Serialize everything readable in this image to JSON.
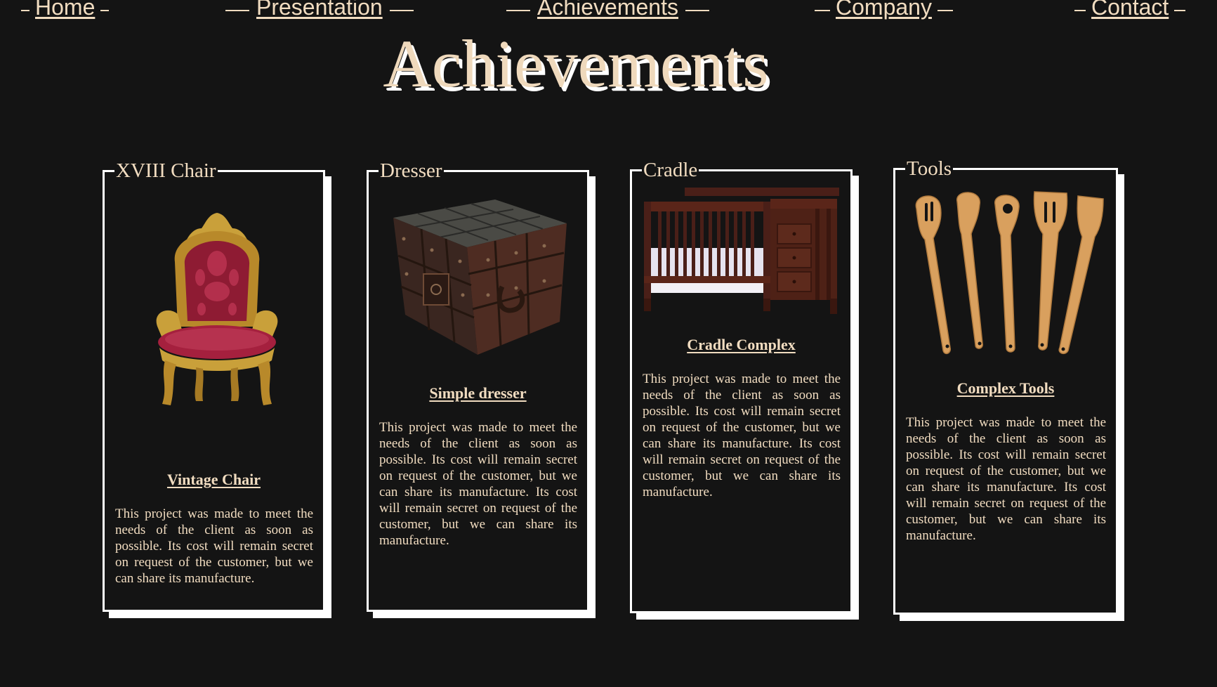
{
  "nav": {
    "items": [
      {
        "label": "Home"
      },
      {
        "label": "Presentation"
      },
      {
        "label": "Achievements"
      },
      {
        "label": "Company"
      },
      {
        "label": "Contact"
      }
    ]
  },
  "page": {
    "title": "Achievements"
  },
  "cards": [
    {
      "legend": "XVIII Chair",
      "heading": "Vintage Chair",
      "text": "This project was made to meet the needs of the client as soon as possible. Its cost will remain secret on request of the customer, but we can share its manufacture.",
      "image": "vintage-chair-image"
    },
    {
      "legend": "Dresser",
      "heading": "Simple dresser",
      "text": "This project was made to meet the needs of the client as soon as possible. Its cost will remain secret on request of the customer, but we can share its manufacture. Its cost will remain secret on request of the customer, but we can share its manufacture.",
      "image": "dresser-image"
    },
    {
      "legend": "Cradle",
      "heading": "Cradle Complex",
      "text": "This project was made to meet the needs of the client as soon as possible. Its cost will remain secret on request of the customer, but we can share its manufacture. Its cost will remain secret on request of the customer, but we can share its manufacture.",
      "image": "cradle-image"
    },
    {
      "legend": "Tools",
      "heading": "Complex Tools",
      "text": "This project was made to meet the needs of the client as soon as possible. Its cost will remain secret on request of the customer, but we can share its manufacture. Its cost will remain secret on request of the customer, but we can share its manufacture.",
      "image": "wooden-tools-image"
    }
  ],
  "colors": {
    "background": "#141414",
    "text": "#f1dcc0",
    "border": "#ffffff"
  }
}
